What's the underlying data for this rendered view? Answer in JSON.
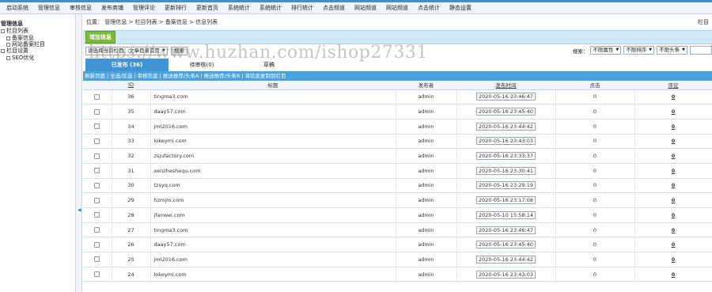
{
  "topnav": [
    "启动系统",
    "管理信息",
    "审核信息",
    "发布商铺",
    "管理评论",
    "更新排行",
    "更新首页",
    "系统统计",
    "系统统计",
    "排行统计",
    "点击频道",
    "网站频道",
    "网站频道",
    "点击统计",
    "静态设置"
  ],
  "sidebar": {
    "section1": "管理信息",
    "group1": "栏目列表",
    "item1": "备案信息",
    "item2": "网站备案栏目",
    "section2": "栏目设置",
    "item3": "SEO优化"
  },
  "breadcrumb": "位置： 管理信息 > 栏目列表 > 备案信息 > 信息列表",
  "breadcrumb_right": "栏目",
  "add_button": "增加信息",
  "filter": {
    "category_select": "请选择当前栏目：文章目录首页",
    "go_button": "搜索",
    "search_label": "搜索：",
    "select1": "不限属性",
    "select2": "不限排序",
    "select3": "不限头条"
  },
  "watermark": "https://www.huzhan.com/ishop27331",
  "tabs": {
    "published": "已发布 (36)",
    "pending": "待审核(0)",
    "draft": "草稿"
  },
  "actions": [
    "刷新页面",
    "全选/反选",
    "审核信息",
    "推送推荐/头条A",
    "推送推荐/头条B",
    "将信息复制到栏目"
  ],
  "columns": {
    "id": "ID",
    "title": "标题",
    "publisher": "发布者",
    "time": "发布时间",
    "clicks": "点击",
    "comments": "评论"
  },
  "rows": [
    {
      "id": "36",
      "title": "tingma3.com",
      "publisher": "admin",
      "time": "2020-05-16 23:46:47",
      "clicks": "0",
      "comments": "0"
    },
    {
      "id": "35",
      "title": "daay57.com",
      "publisher": "admin",
      "time": "2020-05-16 23:45:40",
      "clicks": "0",
      "comments": "0"
    },
    {
      "id": "34",
      "title": "jml2016.com",
      "publisher": "admin",
      "time": "2020-05-16 23:44:42",
      "clicks": "0",
      "comments": "0"
    },
    {
      "id": "33",
      "title": "lokeymi.com",
      "publisher": "admin",
      "time": "2020-05-16 23:43:03",
      "clicks": "0",
      "comments": "0"
    },
    {
      "id": "32",
      "title": "zsjufactory.com",
      "publisher": "admin",
      "time": "2020-05-16 23:33:37",
      "clicks": "0",
      "comments": "0"
    },
    {
      "id": "31",
      "title": "xenzheshequ.com",
      "publisher": "admin",
      "time": "2020-05-16 23:30:41",
      "clicks": "0",
      "comments": "0"
    },
    {
      "id": "30",
      "title": "tzsyq.com",
      "publisher": "admin",
      "time": "2020-05-16 23:29:19",
      "clicks": "0",
      "comments": "0"
    },
    {
      "id": "29",
      "title": "hzmjm.com",
      "publisher": "admin",
      "time": "2020-05-16 23:17:08",
      "clicks": "0",
      "comments": "0"
    },
    {
      "id": "28",
      "title": "jfanwei.com",
      "publisher": "admin",
      "time": "2020-05-10 15:58:14",
      "clicks": "0",
      "comments": "0"
    },
    {
      "id": "27",
      "title": "tingma3.com",
      "publisher": "admin",
      "time": "2020-05-16 23:46:47",
      "clicks": "0",
      "comments": "0"
    },
    {
      "id": "26",
      "title": "daay57.com",
      "publisher": "admin",
      "time": "2020-05-16 23:45:40",
      "clicks": "0",
      "comments": "0"
    },
    {
      "id": "25",
      "title": "jml2016.com",
      "publisher": "admin",
      "time": "2020-05-16 23:44:42",
      "clicks": "0",
      "comments": "0"
    },
    {
      "id": "24",
      "title": "lokeymi.com",
      "publisher": "admin",
      "time": "2020-05-16 23:43:03",
      "clicks": "0",
      "comments": "0"
    }
  ]
}
